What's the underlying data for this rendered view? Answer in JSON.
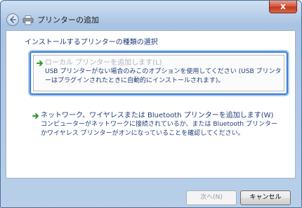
{
  "window": {
    "title": "プリンターの追加",
    "close_label": "x"
  },
  "heading": "インストールするプリンターの種類の選択",
  "options": [
    {
      "title": "ローカル プリンターを追加します(L)",
      "description": "USB プリンターがない場合のみこのオプションを使用してください (USB プリンターはプラグインされたときに自動的にインストールされます)。"
    },
    {
      "title": "ネットワーク、ワイヤレスまたは Bluetooth プリンターを追加します(W)",
      "description": "コンピューターがネットワークに接続されているか、または Bluetooth プリンターかワイヤレス プリンターがオンになっていることを確認してください。"
    }
  ],
  "buttons": {
    "next": "次へ(N)",
    "cancel": "キャンセル"
  },
  "colors": {
    "link_text": "#1e3c78",
    "disabled_text": "#a9b6c6",
    "selection_border": "#3b7ed9",
    "arrow_green": "#2e9b2e"
  },
  "icons": {
    "back": "back-arrow-icon",
    "printer": "printer-icon",
    "option_arrow": "green-arrow-icon",
    "close": "close-icon"
  }
}
